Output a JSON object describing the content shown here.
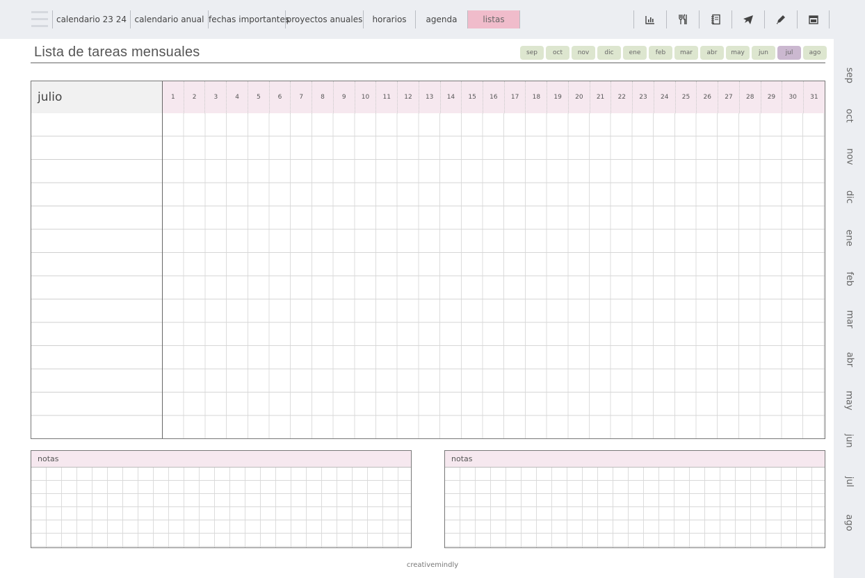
{
  "nav": {
    "tabs": [
      {
        "label": "calendario 23 24"
      },
      {
        "label": "calendario anual"
      },
      {
        "label": "fechas importantes"
      },
      {
        "label": "proyectos anuales"
      },
      {
        "label": "horarios"
      },
      {
        "label": "agenda"
      },
      {
        "label": "listas",
        "active": true
      }
    ],
    "tools": [
      {
        "icon": "bar-chart-icon"
      },
      {
        "icon": "utensils-icon"
      },
      {
        "icon": "notebook-icon"
      },
      {
        "icon": "airplane-icon"
      },
      {
        "icon": "pencil-icon"
      },
      {
        "icon": "calendar-icon"
      }
    ]
  },
  "page": {
    "title": "Lista de tareas mensuales",
    "months": [
      "sep",
      "oct",
      "nov",
      "dic",
      "ene",
      "feb",
      "mar",
      "abr",
      "may",
      "jun",
      "jul",
      "ago"
    ],
    "active_month": "jul"
  },
  "grid": {
    "month_label": "julio",
    "days": [
      "1",
      "2",
      "3",
      "4",
      "5",
      "6",
      "7",
      "8",
      "9",
      "10",
      "11",
      "12",
      "13",
      "14",
      "15",
      "16",
      "17",
      "18",
      "19",
      "20",
      "21",
      "22",
      "23",
      "24",
      "25",
      "26",
      "27",
      "28",
      "29",
      "30",
      "31"
    ]
  },
  "notes": [
    {
      "label": "notas"
    },
    {
      "label": "notas"
    }
  ],
  "sidebar": {
    "months": [
      "sep",
      "oct",
      "nov",
      "dic",
      "ene",
      "feb",
      "mar",
      "abr",
      "may",
      "jun",
      "jul",
      "ago"
    ]
  },
  "footer": {
    "text": "creativemindly"
  },
  "colors": {
    "active_tab": "#f0bccb",
    "month_pill": "#dde6cf",
    "month_pill_active": "#cbb8d0",
    "header_pink": "#f6e8ef",
    "chrome": "#eceef2"
  }
}
